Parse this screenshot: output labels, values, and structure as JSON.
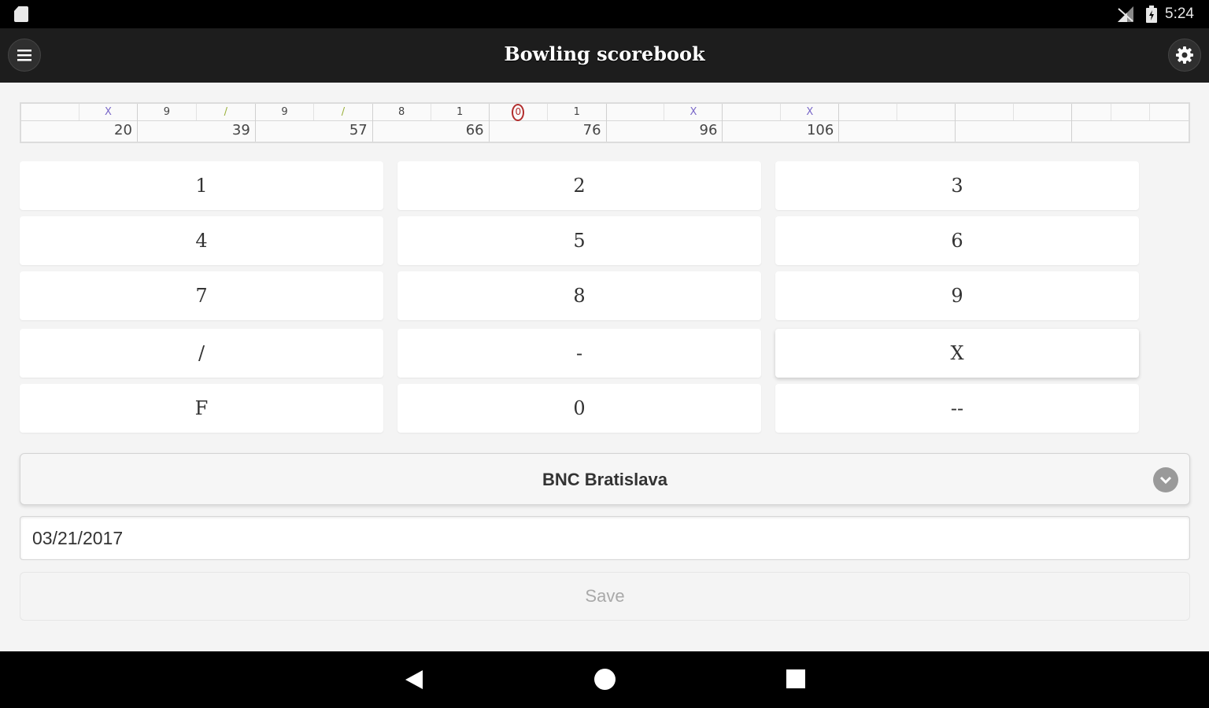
{
  "status_bar": {
    "time": "5:24",
    "icons": [
      "sd-card-icon",
      "signal-icon",
      "battery-icon"
    ]
  },
  "app_bar": {
    "title": "Bowling scorebook",
    "left_icon": "hamburger-menu-icon",
    "right_icon": "gear-icon"
  },
  "scorecard": {
    "frames": [
      {
        "rolls": [
          "",
          "X"
        ],
        "total": "20"
      },
      {
        "rolls": [
          "9",
          "/"
        ],
        "total": "39"
      },
      {
        "rolls": [
          "9",
          "/"
        ],
        "total": "57"
      },
      {
        "rolls": [
          "8",
          "1"
        ],
        "total": "66"
      },
      {
        "rolls": [
          "0",
          "1"
        ],
        "total": "76",
        "current_roll": 0
      },
      {
        "rolls": [
          "",
          "X"
        ],
        "total": "96"
      },
      {
        "rolls": [
          "",
          "X"
        ],
        "total": "106"
      },
      {
        "rolls": [
          "",
          ""
        ],
        "total": ""
      },
      {
        "rolls": [
          "",
          ""
        ],
        "total": ""
      },
      {
        "rolls": [
          "",
          "",
          ""
        ],
        "total": ""
      }
    ],
    "colors": {
      "strike": "#7a68c8",
      "spare": "#9ab03a",
      "current": "#b22c2c"
    }
  },
  "keypad": {
    "keys": [
      "1",
      "2",
      "3",
      "4",
      "5",
      "6",
      "7",
      "8",
      "9",
      "/",
      "-",
      "X",
      "F",
      "0",
      "--"
    ]
  },
  "location": {
    "selected": "BNC Bratislava",
    "icon": "chevron-down-icon"
  },
  "date": {
    "value": "03/21/2017"
  },
  "save": {
    "label": "Save"
  },
  "nav_bar": {
    "icons": [
      "back-icon",
      "home-icon",
      "recents-icon"
    ]
  }
}
